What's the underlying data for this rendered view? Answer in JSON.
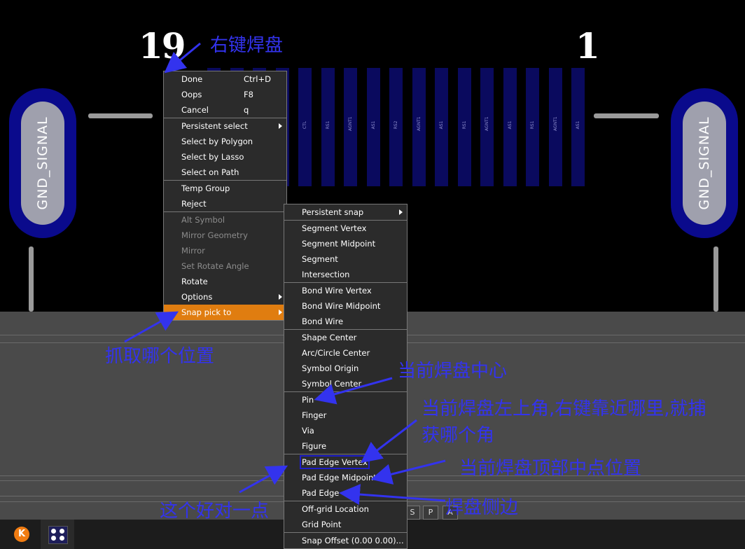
{
  "pcb": {
    "pin_left": "19",
    "pin_right": "1",
    "gnd_left": "GND_SIGNAL",
    "gnd_right": "GND_SIGNAL",
    "pad_labels": [
      "CTL",
      "RS1",
      "AGNT1",
      "AS1",
      "RS2",
      "AGNT1",
      "AS1",
      "RS1",
      "AGNT1",
      "AS1",
      "RS1",
      "AGNT1",
      "AS1"
    ]
  },
  "context_menu": {
    "items": [
      {
        "label": "Done",
        "shortcut": "Ctrl+D"
      },
      {
        "label": "Oops",
        "shortcut": "F8"
      },
      {
        "label": "Cancel",
        "shortcut": "q"
      },
      {
        "label": "Persistent select",
        "submenu": true
      },
      {
        "label": "Select by Polygon"
      },
      {
        "label": "Select by Lasso"
      },
      {
        "label": "Select on Path"
      },
      {
        "label": "Temp Group"
      },
      {
        "label": "Reject"
      },
      {
        "label": "Alt Symbol",
        "disabled": true
      },
      {
        "label": "Mirror Geometry",
        "disabled": true
      },
      {
        "label": "Mirror",
        "disabled": true
      },
      {
        "label": "Set Rotate Angle",
        "disabled": true
      },
      {
        "label": "Rotate"
      },
      {
        "label": "Options",
        "submenu": true
      },
      {
        "label": "Snap pick to",
        "submenu": true,
        "highlighted": true
      }
    ]
  },
  "snap_submenu": {
    "items": [
      {
        "label": "Persistent snap",
        "submenu": true
      },
      {
        "label": "Segment Vertex"
      },
      {
        "label": "Segment Midpoint"
      },
      {
        "label": "Segment"
      },
      {
        "label": "Intersection"
      },
      {
        "label": "Bond Wire Vertex"
      },
      {
        "label": "Bond Wire Midpoint"
      },
      {
        "label": "Bond Wire"
      },
      {
        "label": "Shape Center"
      },
      {
        "label": "Arc/Circle Center"
      },
      {
        "label": "Symbol Origin"
      },
      {
        "label": "Symbol Center"
      },
      {
        "label": "Pin"
      },
      {
        "label": "Finger"
      },
      {
        "label": "Via"
      },
      {
        "label": "Figure"
      },
      {
        "label": "Pad Edge Vertex",
        "boxed": true
      },
      {
        "label": "Pad Edge Midpoint"
      },
      {
        "label": "Pad Edge"
      },
      {
        "label": "Off-grid Location"
      },
      {
        "label": "Grid Point"
      },
      {
        "label": "Snap Offset (0.00 0.00)..."
      }
    ]
  },
  "annotations": {
    "right_click_pad": "右键焊盘",
    "snap_where": "抓取哪个位置",
    "pad_center": "当前焊盘中心",
    "pad_corner_line1": "当前焊盘左上角,右键靠近哪里,就捕",
    "pad_corner_line2": "获哪个角",
    "pad_top_mid": "当前焊盘顶部中点位置",
    "good_align": "这个好对一点",
    "pad_side": "焊盘侧边"
  },
  "toolbar": {
    "btn_p": "P",
    "btn_a": "A",
    "btn_s": "S"
  },
  "taskbar": {
    "app1_icon": "k-logo-icon",
    "app2_icon": "pcb-app-icon",
    "app1_letter": "K"
  },
  "colors": {
    "highlight": "#e07d10",
    "annotation": "#3333ee",
    "pad": "#0a0a5e",
    "gnd_ring": "#0a0a8c"
  }
}
